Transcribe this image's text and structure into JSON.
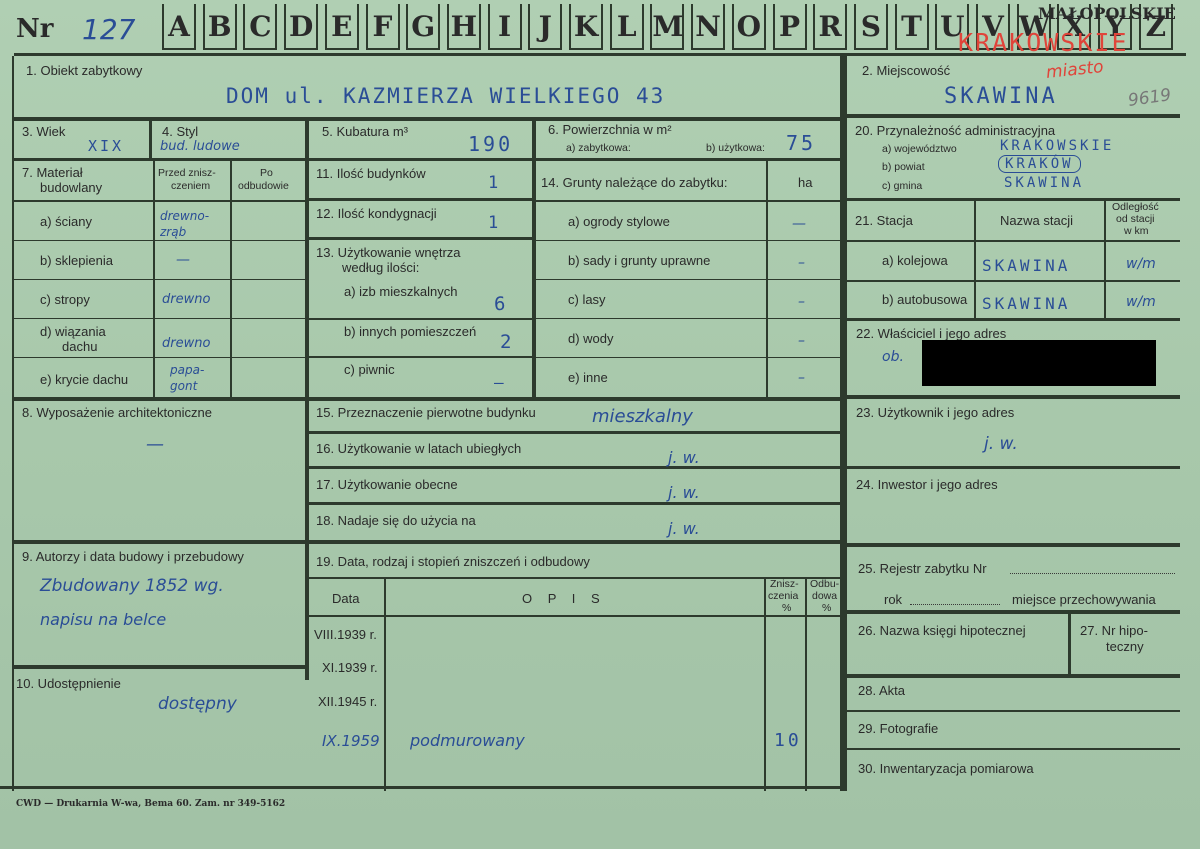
{
  "header": {
    "nr_label": "Nr",
    "nr_value": "127",
    "letters": [
      "A",
      "B",
      "C",
      "D",
      "E",
      "F",
      "G",
      "H",
      "I",
      "J",
      "K",
      "L",
      "M",
      "N",
      "O",
      "P",
      "R",
      "S",
      "T",
      "U",
      "V",
      "W",
      "X",
      "Y",
      "Z"
    ],
    "voivodeship_stamp": "MAŁOPOLSKIE",
    "region_red": "KRAKOWSKIE",
    "city_red": "miasto",
    "number_gray": "9619"
  },
  "f1": {
    "label": "1. Obiekt zabytkowy",
    "value": "DOM   ul. KAZMIERZA  WIELKIEGO 43"
  },
  "f2": {
    "label": "2. Miejscowość",
    "value": "SKAWINA"
  },
  "f3": {
    "label": "3. Wiek",
    "value": "XIX"
  },
  "f4": {
    "label": "4. Styl",
    "value": "bud. ludowe"
  },
  "f5": {
    "label": "5. Kubatura m³",
    "value": "190"
  },
  "f6": {
    "label": "6. Powierzchnia w m²",
    "a_label": "a) zabytkowa:",
    "b_label": "b) użytkowa:",
    "b_value": "75"
  },
  "f20": {
    "label": "20. Przynależność administracyjna",
    "a_label": "a) województwo",
    "a_value": "KRAKOWSKIE",
    "b_label": "b) powiat",
    "b_value": "KRAKÓW",
    "c_label": "c) gmina",
    "c_value": "SKAWINA"
  },
  "f7": {
    "label_line1": "7. Materiał",
    "label_line2": "budowlany",
    "col_before_1": "Przed znisz-",
    "col_before_2": "czeniem",
    "col_after_1": "Po",
    "col_after_2": "odbudowie",
    "rows": [
      {
        "label": "a) ściany",
        "value": "drewno-zrąb"
      },
      {
        "label": "b) sklepienia",
        "value": "—"
      },
      {
        "label": "c) stropy",
        "value": "drewno"
      },
      {
        "label_1": "d) wiązania",
        "label_2": "dachu",
        "value": "drewno"
      },
      {
        "label": "e) krycie dachu",
        "value": "papa-gont"
      }
    ]
  },
  "f11": {
    "label": "11. Ilość budynków",
    "value": "1"
  },
  "f12": {
    "label": "12. Ilość kondygnacji",
    "value": "1"
  },
  "f13": {
    "label_1": "13. Użytkowanie wnętrza",
    "label_2": "według ilości:",
    "a_label": "a) izb mieszkalnych",
    "a_value": "6",
    "b_label": "b) innych pomieszczeń",
    "b_value": "2",
    "c_label": "c) piwnic",
    "c_value": "–"
  },
  "f14": {
    "label": "14. Grunty należące do zabytku:",
    "unit": "ha",
    "rows": [
      {
        "label": "a) ogrody stylowe",
        "value": "—"
      },
      {
        "label": "b) sady i grunty uprawne",
        "value": "–"
      },
      {
        "label": "c) lasy",
        "value": "–"
      },
      {
        "label": "d) wody",
        "value": "–"
      },
      {
        "label": "e) inne",
        "value": "–"
      }
    ]
  },
  "f21": {
    "label": "21. Stacja",
    "col_name": "Nazwa stacji",
    "col_dist_1": "Odległość",
    "col_dist_2": "od stacji",
    "col_dist_3": "w km",
    "a_label": "a) kolejowa",
    "a_value": "SKAWINA",
    "a_dist": "w/m",
    "b_label": "b) autobusowa",
    "b_value": "SKAWINA",
    "b_dist": "w/m"
  },
  "f22": {
    "label": "22. Właściciel i jego adres",
    "value": "ob."
  },
  "f8": {
    "label": "8. Wyposażenie architektoniczne",
    "value": "—"
  },
  "f15": {
    "label": "15. Przeznaczenie pierwotne budynku",
    "value": "mieszkalny"
  },
  "f16": {
    "label": "16. Użytkowanie w latach ubiegłych",
    "value": "j. w."
  },
  "f17": {
    "label": "17. Użytkowanie obecne",
    "value": "j. w."
  },
  "f18": {
    "label": "18. Nadaje się do użycia na",
    "value": "j. w."
  },
  "f23": {
    "label": "23. Użytkownik i jego adres",
    "value": "j. w."
  },
  "f24": {
    "label": "24. Inwestor i jego adres"
  },
  "f9": {
    "label": "9. Autorzy i data budowy i przebudowy",
    "value_1": "Zbudowany 1852 wg.",
    "value_2": "napisu na belce"
  },
  "f10": {
    "label": "10. Udostępnienie",
    "value": "dostępny"
  },
  "f19": {
    "label": "19. Data, rodzaj i stopień zniszczeń i odbudowy",
    "col_date": "Data",
    "col_desc": "O P I S",
    "col_destr_1": "Znisz-",
    "col_destr_2": "czenia",
    "col_destr_3": "%",
    "col_rebuild_1": "Odbu-",
    "col_rebuild_2": "dowa",
    "col_rebuild_3": "%",
    "rows": [
      {
        "date": "VIII.1939 r.",
        "desc": "",
        "destr": ""
      },
      {
        "date": "XI.1939 r.",
        "desc": "",
        "destr": ""
      },
      {
        "date": "XII.1945 r.",
        "desc": "",
        "destr": ""
      },
      {
        "date": "IX.1959",
        "desc": "podmurowany",
        "destr": "10"
      }
    ]
  },
  "f25": {
    "label": "25. Rejestr zabytku Nr",
    "rok": "rok",
    "place": "miejsce przechowywania"
  },
  "f26": {
    "label": "26. Nazwa księgi hipotecznej"
  },
  "f27": {
    "label_1": "27. Nr hipo-",
    "label_2": "teczny"
  },
  "f28": {
    "label": "28. Akta"
  },
  "f29": {
    "label": "29. Fotografie"
  },
  "f30": {
    "label": "30. Inwentaryzacja pomiarowa"
  },
  "footer": {
    "printer": "CWD — Drukarnia W-wa, Bema 60. Zam. nr 349-5162"
  }
}
